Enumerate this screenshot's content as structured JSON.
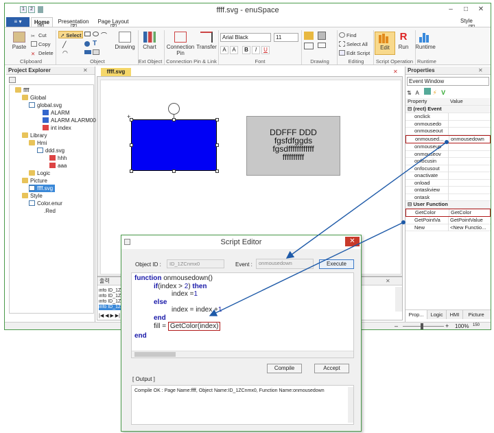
{
  "window": {
    "title": "ffff.svg - enuSpace",
    "qat_1": "1",
    "qat_2": "2",
    "style_label": "Style",
    "style_key": "S"
  },
  "ribbon": {
    "file_label": "",
    "tabs": [
      {
        "label": "Home",
        "key": "H"
      },
      {
        "label": "Presentation",
        "key": "P"
      },
      {
        "label": "Page Layout",
        "key": "P"
      }
    ],
    "clipboard": {
      "paste": "Paste",
      "cut": "Cut",
      "copy": "Copy",
      "delete": "Delete",
      "label": "Clipboard"
    },
    "object": {
      "select": "Select",
      "label": "Object",
      "drawing": "Drawing"
    },
    "ext_object": {
      "chart": "Chart",
      "label": "Ext Object"
    },
    "connection": {
      "pin": "Connection Pin",
      "transfer": "Transfer",
      "label": "Connection Pin & Link"
    },
    "font": {
      "name": "Arial Black",
      "size": "11",
      "bold": "B",
      "italic": "I",
      "underline": "U",
      "label": "Font"
    },
    "drawing": {
      "label": "Drawing"
    },
    "editing": {
      "find": "Find",
      "select_all": "Select All",
      "edit_script": "Edit Script",
      "label": "Editing"
    },
    "script": {
      "edit": "Edit",
      "run": "Run",
      "runtime": "Runtime",
      "label": "Script Operation"
    },
    "runtime": {
      "runtime": "Runtime",
      "label": "Runtime"
    }
  },
  "explorer": {
    "title": "Project Explorer",
    "items": [
      {
        "label": "ffff"
      },
      {
        "label": "Global"
      },
      {
        "label": "global.svg"
      },
      {
        "label": "ALARM"
      },
      {
        "label": "ALARM ALARM00"
      },
      {
        "label": "int index"
      },
      {
        "label": "Library"
      },
      {
        "label": "Hmi"
      },
      {
        "label": "ddd.svg"
      },
      {
        "label": "hhh"
      },
      {
        "label": "aaa"
      },
      {
        "label": "Logic"
      },
      {
        "label": "Picture"
      },
      {
        "label": "ffff.svg"
      },
      {
        "label": "Style"
      },
      {
        "label": "Color.enur"
      },
      {
        "label": ".Red"
      }
    ]
  },
  "canvas": {
    "doc_tab": "ffff.svg",
    "text_lines": [
      "DDFFF DDD",
      "fgsfdfggds",
      "fgsdffffffffffff",
      "ffffffffff"
    ]
  },
  "output_pane": {
    "title": "출력",
    "lines": [
      "info ID_1ZC",
      "info ID_1ZC",
      "info ID_1ZC",
      "info ID_1ZC"
    ]
  },
  "properties": {
    "title": "Properties",
    "dropdown": "Event Window",
    "col_property": "Property",
    "col_value": "Value",
    "category_event": "(rect) Event",
    "events": [
      {
        "name": "onclick",
        "value": ""
      },
      {
        "name": "onmousedo",
        "value": ""
      },
      {
        "name": "onmouseout",
        "value": ""
      },
      {
        "name": "onmoused...",
        "value": "onmousedown"
      },
      {
        "name": "onmouseup",
        "value": ""
      },
      {
        "name": "onmouseov",
        "value": ""
      },
      {
        "name": "onfocusin",
        "value": ""
      },
      {
        "name": "onfocusout",
        "value": ""
      },
      {
        "name": "onactivate",
        "value": ""
      },
      {
        "name": "onload",
        "value": ""
      },
      {
        "name": "ontaskview",
        "value": ""
      },
      {
        "name": "ontask",
        "value": ""
      }
    ],
    "category_user": "User Function",
    "user_functions": [
      {
        "name": "GetColor",
        "value": "GetColor"
      },
      {
        "name": "GetPointVa",
        "value": "GetPointValue"
      },
      {
        "name": "New",
        "value": "<New Functio..."
      }
    ],
    "bottom_tabs": [
      "Prop...",
      "Logic",
      "HMI",
      "Picture"
    ]
  },
  "status": {
    "zoom": "100%",
    "fit": "150"
  },
  "dialog": {
    "title": "Script Editor",
    "object_id_label": "Object ID :",
    "object_id_value": "ID_1ZCnmx0",
    "event_label": "Event :",
    "event_value": "onmousedown",
    "execute": "Execute",
    "compile": "Compile",
    "accept": "Accept",
    "output_label": "[ Output ]",
    "output_text": "Compile OK : Page Name:ffff, Object Name:ID_1ZCnmx0, Function Name:onmousedown",
    "code": {
      "l1_kw": "function",
      "l1_rest": " onmousedown()",
      "l2_kw": "if",
      "l2_a": "(index > ",
      "l2_num": "2",
      "l2_b": ") ",
      "l2_then": "then",
      "l3_a": "index =",
      "l3_num": "1",
      "l4_kw": "else",
      "l5_a": "index = index +",
      "l5_num": "1",
      "l6_kw": "end",
      "l7_a": "fill = ",
      "l7_call": "GetColor(index)",
      "l8_kw": "end"
    }
  },
  "colors": {
    "file_button": "#2b5faa",
    "selected_rect": "#0000f5",
    "highlight": "#b01818",
    "arrow": "#1e5aa8",
    "keyword": "#1818a8"
  }
}
